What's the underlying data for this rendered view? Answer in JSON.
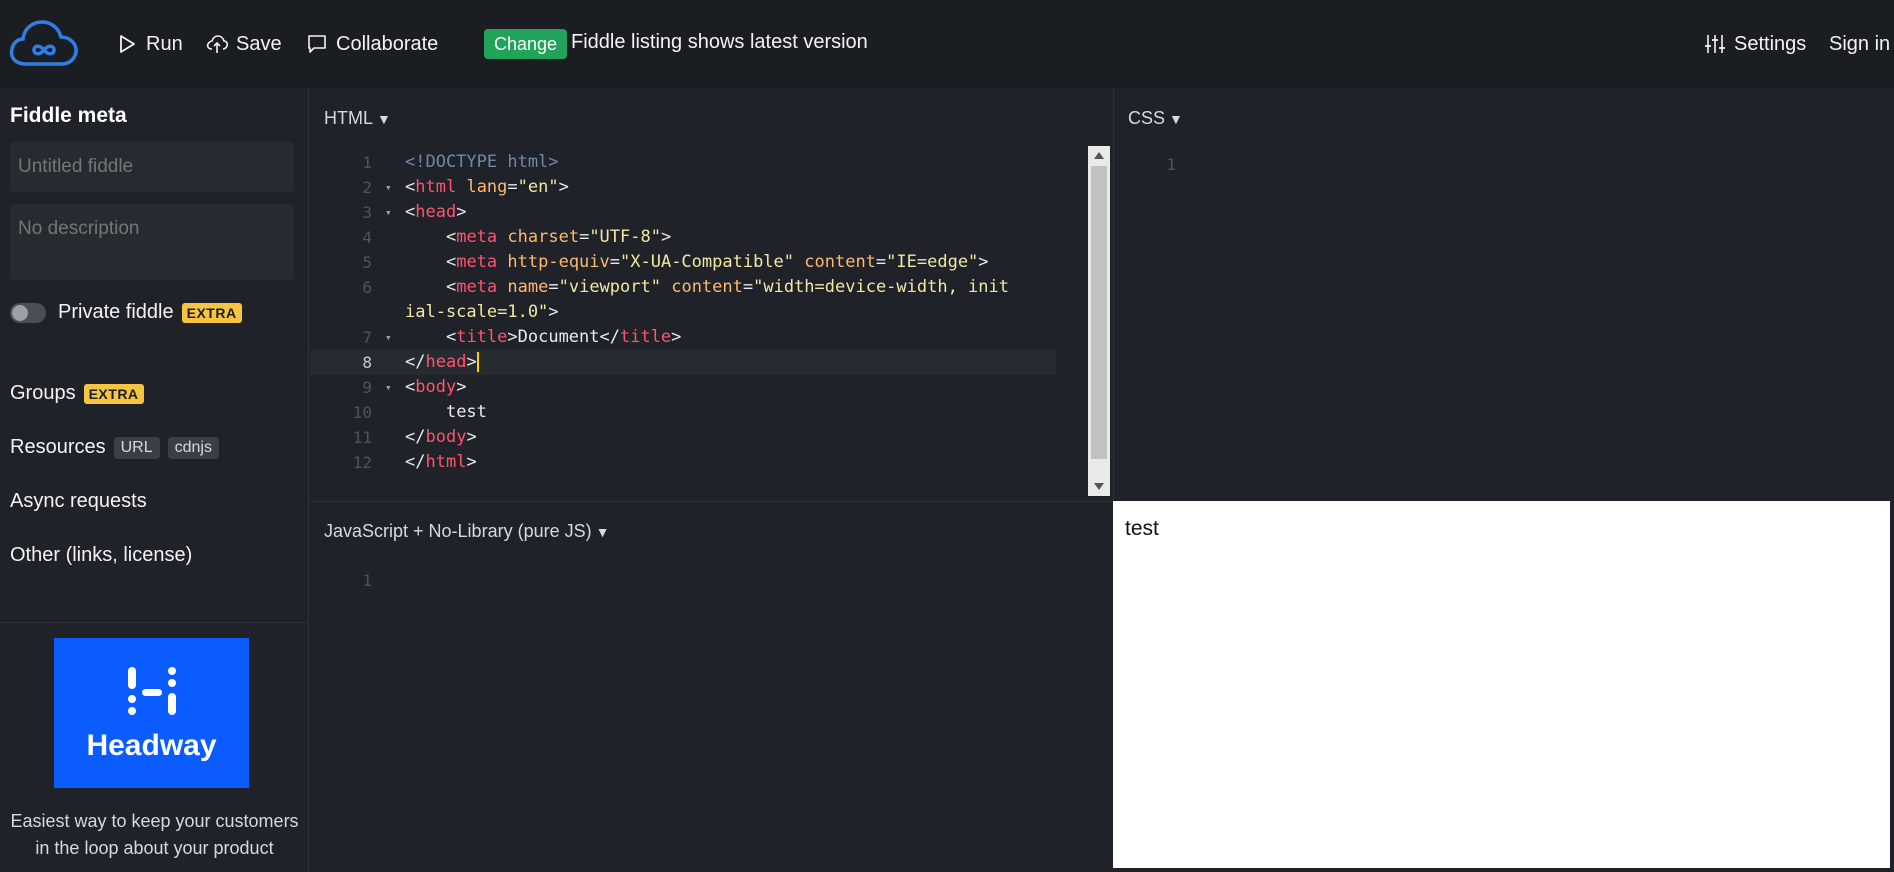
{
  "topbar": {
    "run_label": "Run",
    "save_label": "Save",
    "collaborate_label": "Collaborate",
    "change_badge": "Change",
    "change_text": "Fiddle listing shows latest version",
    "settings_label": "Settings",
    "signin_label": "Sign in"
  },
  "sidebar": {
    "title": "Fiddle meta",
    "title_placeholder": "Untitled fiddle",
    "description_placeholder": "No description",
    "private_label": "Private fiddle",
    "extra_badge": "EXTRA",
    "groups_label": "Groups",
    "resources_label": "Resources",
    "resources_url_chip": "URL",
    "resources_cdnjs_chip": "cdnjs",
    "async_label": "Async requests",
    "other_label": "Other (links, license)",
    "ad": {
      "brand": "Headway",
      "text_line1": "Easiest way to keep your customers",
      "text_line2": "in the loop about your product"
    }
  },
  "panels": {
    "html_title": "HTML",
    "css_title": "CSS",
    "js_title": "JavaScript + No-Library (pure JS)",
    "caret": "▼"
  },
  "html_code": {
    "line_numbers": [
      "1",
      "2",
      "3",
      "4",
      "5",
      "6",
      "7",
      "8",
      "9",
      "10",
      "11",
      "12"
    ]
  },
  "css_code": {
    "line_numbers": [
      "1"
    ]
  },
  "js_code": {
    "line_numbers": [
      "1"
    ]
  },
  "result": {
    "text": "test"
  },
  "colors": {
    "accent_green": "#22a35a",
    "extra_yellow": "#f5c542",
    "headway_blue": "#0b5cff",
    "logo_blue": "#2f7fe6"
  }
}
